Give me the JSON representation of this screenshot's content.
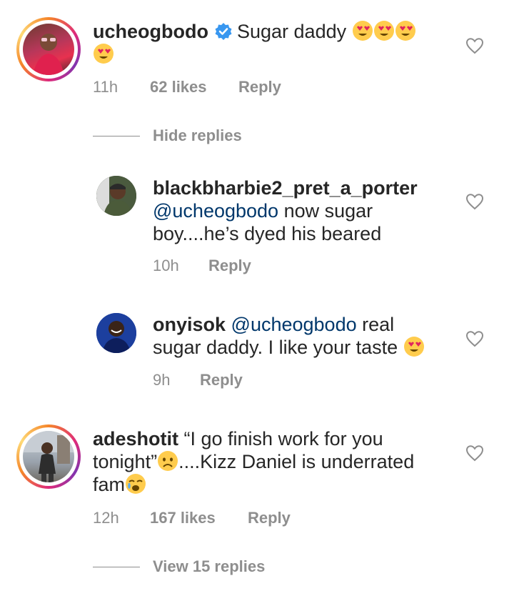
{
  "comments": [
    {
      "username": "ucheogbodo",
      "text_before": "Sugar daddy",
      "time": "11h",
      "likes": "62 likes",
      "reply": "Reply"
    },
    {
      "username": "blackbharbie2_pret_a_porter",
      "mention": "@ucheogbodo",
      "text_a": " now sugar",
      "text_b": "boy....he’s dyed his beared",
      "time": "10h",
      "reply": "Reply"
    },
    {
      "username": "onyisok",
      "mention": "@ucheogbodo",
      "text_a": " real",
      "text_b": "sugar daddy. I like your taste",
      "time": "9h",
      "reply": "Reply"
    },
    {
      "username": "adeshotit",
      "text_a": " “I go finish work for you",
      "text_b": "tonight”",
      "text_c": "....Kizz Daniel is underrated",
      "text_d": "fam",
      "time": "12h",
      "likes": "167 likes",
      "reply": "Reply"
    }
  ],
  "hide_replies": "Hide replies",
  "view_replies": "View 15 replies",
  "colors": {
    "mention": "#00376b",
    "meta": "#8e8e8e",
    "verified": "#3897f0",
    "emoji": "#ffcc4d",
    "heart_eyes": "#e0245e"
  }
}
